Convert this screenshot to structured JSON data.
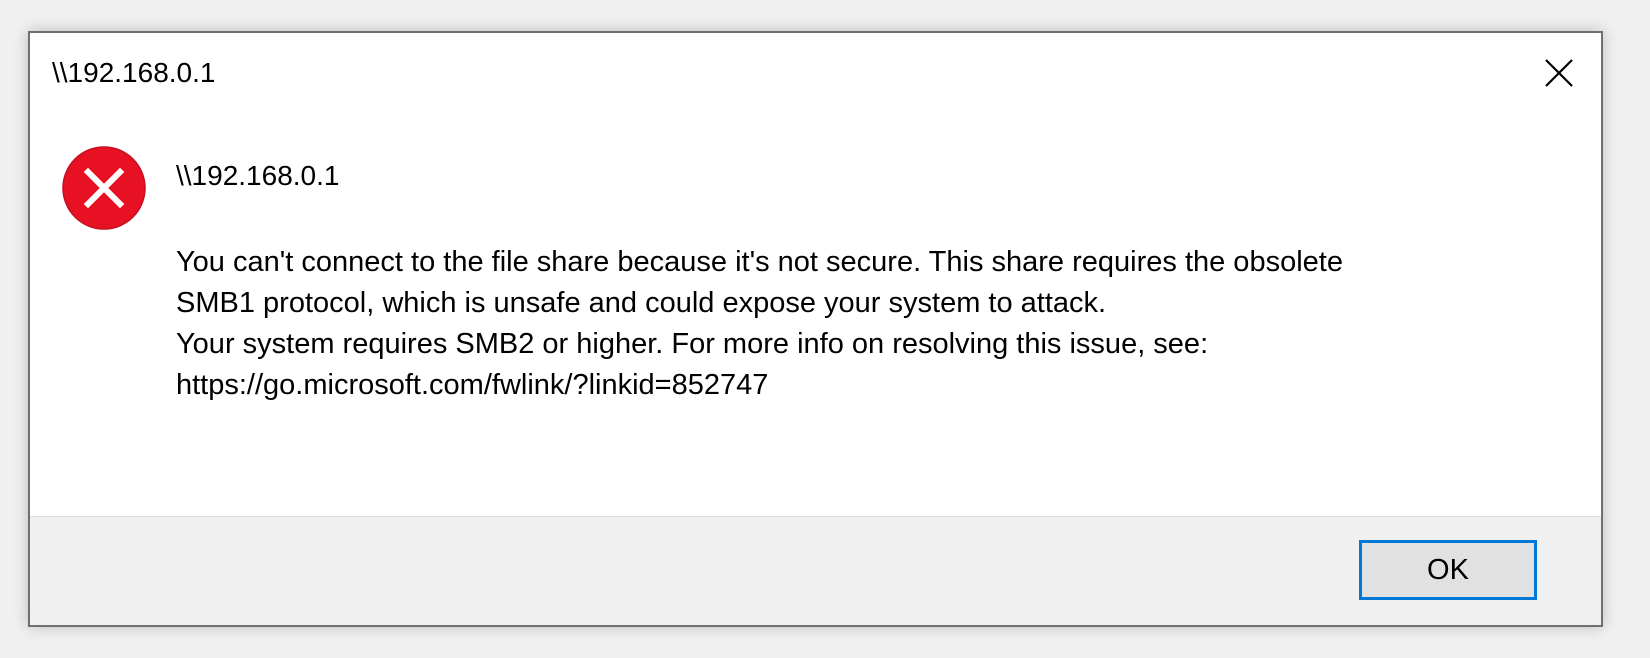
{
  "window": {
    "title": "\\\\192.168.0.1"
  },
  "icons": {
    "error": "error-icon",
    "close": "close-icon",
    "error_color": "#e81123"
  },
  "content": {
    "main_instruction": "\\\\192.168.0.1",
    "message_lines": [
      "You can't connect to the file share because it's not secure. This share requires the obsolete",
      "SMB1 protocol, which is unsafe and could expose your system to attack.",
      "Your system requires SMB2 or higher. For more info on resolving this issue, see:",
      "https://go.microsoft.com/fwlink/?linkid=852747"
    ]
  },
  "footer": {
    "ok_label": "OK"
  },
  "colors": {
    "accent": "#0078d7",
    "footer_bg": "#f0f0f0",
    "button_bg": "#e1e1e1"
  }
}
